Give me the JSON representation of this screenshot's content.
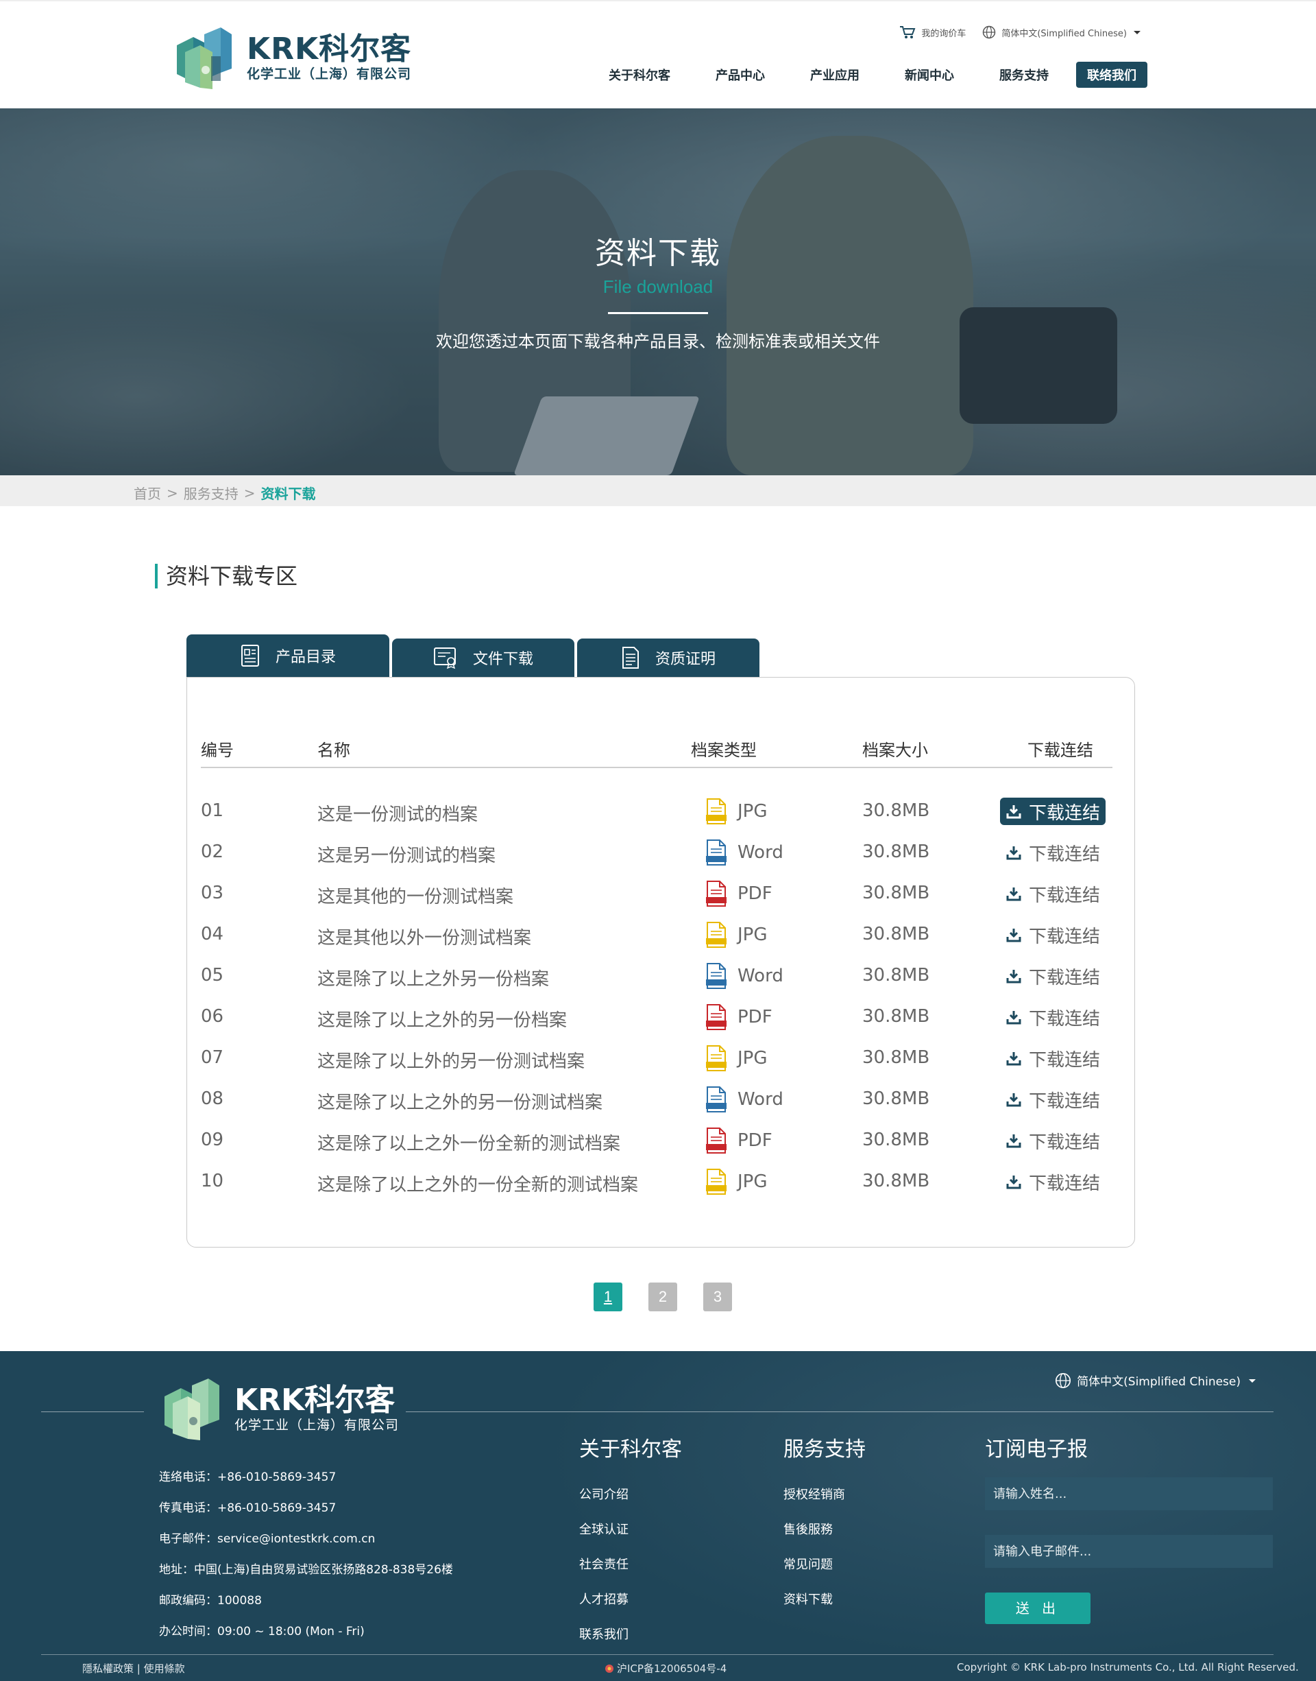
{
  "header": {
    "logo_main": "KRK科尔客",
    "logo_sub": "化学工业（上海）有限公司",
    "cart_label": "我的询价车",
    "lang_label": "简体中文(Simplified Chinese)",
    "nav": [
      "关于科尔客",
      "产品中心",
      "产业应用",
      "新闻中心",
      "服务支持"
    ],
    "contact_btn": "联络我们"
  },
  "hero": {
    "title": "资料下载",
    "subtitle": "File download",
    "desc": "欢迎您透过本页面下载各种产品目录、检测标准表或相关文件"
  },
  "breadcrumb": [
    "首页",
    "服务支持",
    "资料下载"
  ],
  "breadcrumb_sep": ">",
  "section_title": "资料下载专区",
  "tabs": [
    "产品目录",
    "文件下载",
    "资质证明"
  ],
  "table": {
    "headers": [
      "编号",
      "名称",
      "档案类型",
      "档案大小",
      "下载连结"
    ],
    "rows": [
      {
        "no": "01",
        "name": "这是一份测试的档案",
        "type": "JPG",
        "size": "30.8MB",
        "link": "下载连结"
      },
      {
        "no": "02",
        "name": "这是另一份测试的档案",
        "type": "Word",
        "size": "30.8MB",
        "link": "下载连结"
      },
      {
        "no": "03",
        "name": "这是其他的一份测试档案",
        "type": "PDF",
        "size": "30.8MB",
        "link": "下载连结"
      },
      {
        "no": "04",
        "name": "这是其他以外一份测试档案",
        "type": "JPG",
        "size": "30.8MB",
        "link": "下载连结"
      },
      {
        "no": "05",
        "name": "这是除了以上之外另一份档案",
        "type": "Word",
        "size": "30.8MB",
        "link": "下载连结"
      },
      {
        "no": "06",
        "name": "这是除了以上之外的另一份档案",
        "type": "PDF",
        "size": "30.8MB",
        "link": "下载连结"
      },
      {
        "no": "07",
        "name": "这是除了以上外的另一份测试档案",
        "type": "JPG",
        "size": "30.8MB",
        "link": "下载连结"
      },
      {
        "no": "08",
        "name": "这是除了以上之外的另一份测试档案",
        "type": "Word",
        "size": "30.8MB",
        "link": "下载连结"
      },
      {
        "no": "09",
        "name": "这是除了以上之外一份全新的测试档案",
        "type": "PDF",
        "size": "30.8MB",
        "link": "下载连结"
      },
      {
        "no": "10",
        "name": "这是除了以上之外的一份全新的测试档案",
        "type": "JPG",
        "size": "30.8MB",
        "link": "下载连结"
      }
    ]
  },
  "file_colors": {
    "JPG": "#e8b800",
    "Word": "#2b6fa8",
    "PDF": "#c8262a"
  },
  "pagination": [
    "1",
    "2",
    "3"
  ],
  "footer": {
    "logo_main": "KRK科尔客",
    "logo_sub": "化学工业（上海）有限公司",
    "lang_label": "简体中文(Simplified Chinese)",
    "contact": [
      "连络电话：+86-010-5869-3457",
      "传真电话：+86-010-5869-3457",
      "电子邮件：service@iontestkrk.com.cn",
      "地址：中国(上海)自由贸易试验区张扬路828-838号26楼",
      "邮政编码：100088",
      "办公时间：09:00 ~ 18:00 (Mon - Fri)"
    ],
    "about": {
      "title": "关于科尔客",
      "links": [
        "公司介绍",
        "全球认证",
        "社会责任",
        "人才招募",
        "联系我们"
      ]
    },
    "service": {
      "title": "服务支持",
      "links": [
        "授权经销商",
        "售後服務",
        "常见问题",
        "资料下载"
      ]
    },
    "subscribe": {
      "title": "订阅电子报",
      "name_placeholder": "请输入姓名...",
      "email_placeholder": "请输入电子邮件...",
      "send": "送 出"
    },
    "policy": "隱私權政策 | 使用條款",
    "icp": "沪ICP备12006504号-4",
    "copyright": "Copyright © KRK Lab-pro Instruments Co., Ltd. All Right Reserved."
  },
  "colors": {
    "primary": "#1d4a5e",
    "accent": "#1aa39a"
  }
}
